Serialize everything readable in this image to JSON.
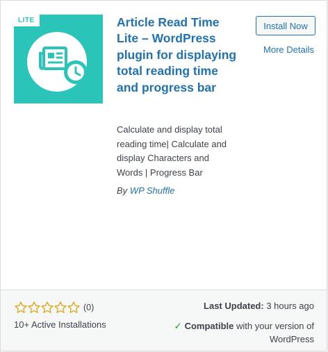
{
  "plugin": {
    "badge": "LITE",
    "name": "Article Read Time Lite – WordPress plugin for displaying total reading time and progress bar",
    "description": "Calculate and display total reading time| Calculate and display Characters and Words | Progress Bar",
    "author_prefix": "By",
    "author_name": "WP Shuffle",
    "icon": "newspaper-clock-icon",
    "brand_color": "#2bc4b8"
  },
  "actions": {
    "install_label": "Install Now",
    "details_label": "More Details"
  },
  "footer": {
    "rating_stars": 0,
    "rating_max": 5,
    "rating_count": "(0)",
    "active_installs": "10+ Active Installations",
    "last_updated_label": "Last Updated:",
    "last_updated_value": "3 hours ago",
    "compatible_label": "Compatible",
    "compatible_text": "with your version of WordPress",
    "compatible_color": "#00a32a"
  }
}
